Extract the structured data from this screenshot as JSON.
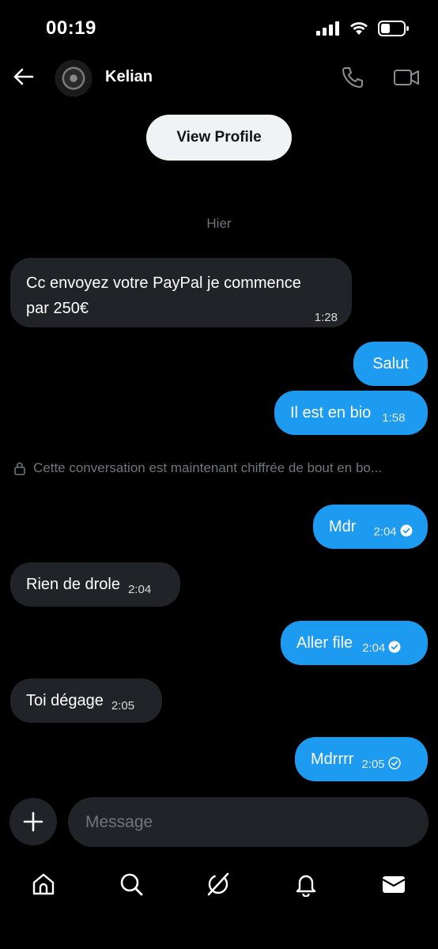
{
  "status_bar": {
    "time": "00:19"
  },
  "header": {
    "contact_name": "Kelian"
  },
  "view_profile_label": "View Profile",
  "date_separator": "Hier",
  "encryption_note": "Cette conversation est maintenant chiffrée de bout en bo...",
  "messages": [
    {
      "direction": "in",
      "line1": "Cc envoyez votre PayPal je commence",
      "line2": "par 250€",
      "time": "1:28"
    },
    {
      "direction": "out",
      "text": "Salut",
      "time": ""
    },
    {
      "direction": "out",
      "text": "Il est en bio",
      "time": "1:58"
    },
    {
      "direction": "out",
      "text": "Mdr",
      "time": "2:04",
      "status": "read"
    },
    {
      "direction": "in",
      "text": "Rien de drole",
      "time": "2:04"
    },
    {
      "direction": "out",
      "text": "Aller file",
      "time": "2:04",
      "status": "read"
    },
    {
      "direction": "in",
      "text": "Toi dégage",
      "time": "2:05"
    },
    {
      "direction": "out",
      "text": "Mdrrrr",
      "time": "2:05",
      "status": "sent"
    }
  ],
  "composer": {
    "placeholder": "Message"
  },
  "nav": [
    "home-icon",
    "search-icon",
    "grok-icon",
    "notifications-icon",
    "messages-icon"
  ],
  "colors": {
    "accent": "#1d9bf0",
    "incoming_bubble": "#202327",
    "muted_text": "#71767b",
    "background": "#000000"
  }
}
